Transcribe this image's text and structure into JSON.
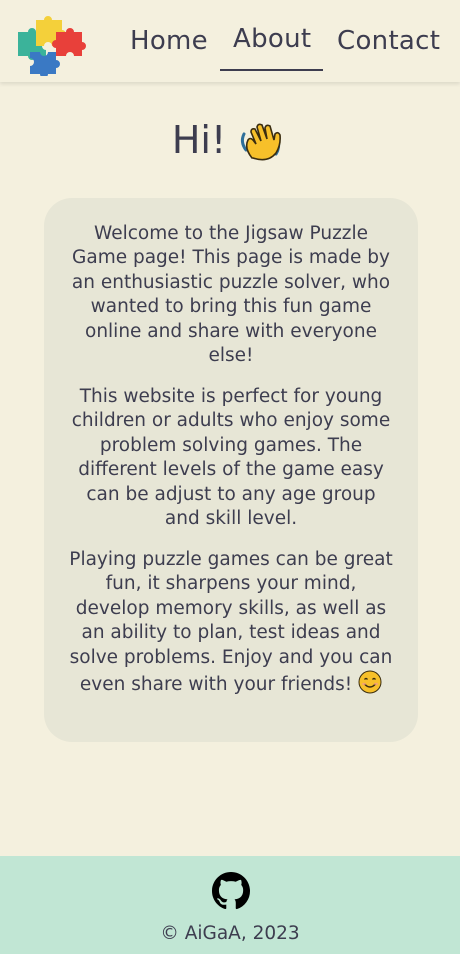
{
  "nav": {
    "items": [
      {
        "label": "Home"
      },
      {
        "label": "About"
      },
      {
        "label": "Contact"
      }
    ],
    "active": "About"
  },
  "main": {
    "heading": "Hi!",
    "paragraphs": [
      "Welcome to the Jigsaw Puzzle Game page! This page is made by an enthusiastic puzzle solver, who wanted to bring this fun game online and share with everyone else!",
      "This website is perfect for young children or adults who enjoy some problem solving games. The different levels of the game easy can be adjust to any age group and skill level.",
      "Playing puzzle games can be great fun, it sharpens your mind, develop memory skills, as well as an ability to plan, test ideas and solve problems. Enjoy and you can even share with your friends!"
    ]
  },
  "footer": {
    "copyright": "© AiGaA, 2023",
    "icon": "github-icon"
  },
  "colors": {
    "background": "#f4f0de",
    "card": "#e7e6d6",
    "footer": "#c1e6d4",
    "text": "#3d3d4f",
    "logo_teal": "#3bb39a",
    "logo_yellow": "#f4d03a",
    "logo_red": "#e8403a",
    "logo_blue": "#3a79c4"
  }
}
